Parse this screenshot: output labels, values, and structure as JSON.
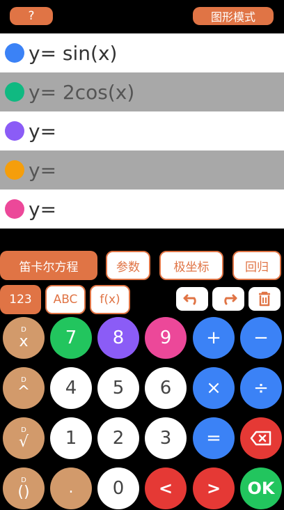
{
  "header": {
    "help_label": "?",
    "graph_mode_label": "图形模式"
  },
  "functions": [
    {
      "label": "y= sin(x)",
      "color": "#3b82f6"
    },
    {
      "label": "y= 2cos(x)",
      "color": "#10b981"
    },
    {
      "label": "y=",
      "color": "#8b5cf6"
    },
    {
      "label": "y=",
      "color": "#f59e0b"
    },
    {
      "label": "y=",
      "color": "#ec4899"
    }
  ],
  "modes": {
    "cartesian": "笛卡尔方程",
    "parametric": "参数",
    "polar": "极坐标",
    "regression": "回归"
  },
  "keyboard_tabs": {
    "numbers": "123",
    "letters": "ABC",
    "functions": "f(x)"
  },
  "keys": {
    "sup": "D",
    "x": "x",
    "pow": "^",
    "sqrt": "√",
    "paren": "()",
    "seven": "7",
    "eight": "8",
    "nine": "9",
    "four": "4",
    "five": "5",
    "six": "6",
    "one": "1",
    "two": "2",
    "three": "3",
    "dot": ".",
    "zero": "0",
    "plus": "+",
    "minus": "−",
    "times": "×",
    "divide": "÷",
    "equals": "=",
    "left": "<",
    "right": ">",
    "ok": "OK"
  },
  "colors": {
    "accent": "#e07445",
    "blue": "#3b82f6",
    "red": "#e53935",
    "green": "#22c55e",
    "tan": "#d29a6b"
  }
}
